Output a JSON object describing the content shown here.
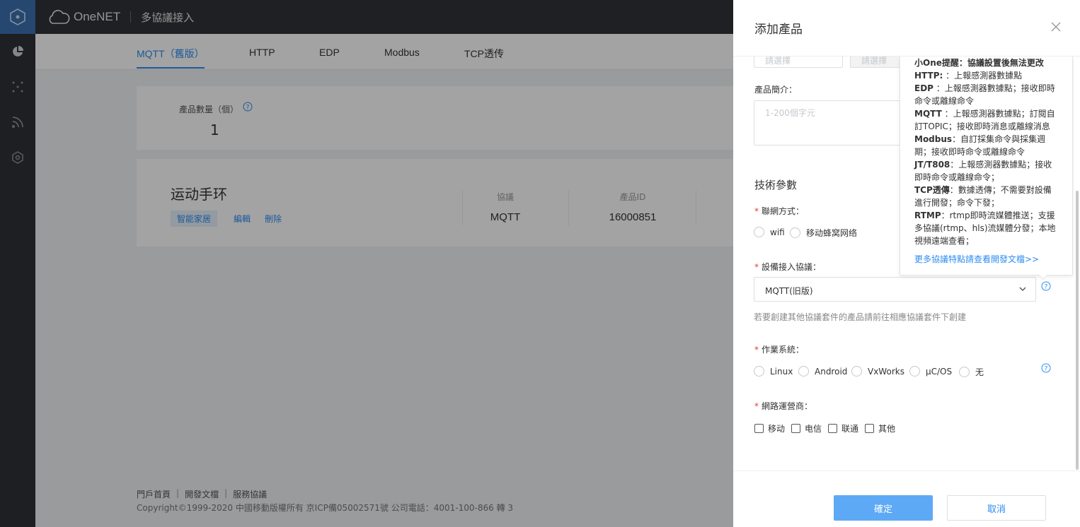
{
  "colors": {
    "accent": "#2d8cf0",
    "sidebar": "#2f3137",
    "topbar": "#303237",
    "required": "#e4393c",
    "ok_button": "#5ea9f5"
  },
  "topbar": {
    "logo_text": "OneNET",
    "title": "多協議接入"
  },
  "tabs": [
    {
      "label": "MQTT（舊版）",
      "active": true
    },
    {
      "label": "HTTP"
    },
    {
      "label": "EDP"
    },
    {
      "label": "Modbus"
    },
    {
      "label": "TCP透传"
    }
  ],
  "stats": {
    "label": "產品數量（個）",
    "value": "1"
  },
  "product": {
    "name": "运动手环",
    "tag": "智能家居",
    "edit": "編輯",
    "delete": "刪除",
    "protocol_header": "協議",
    "protocol": "MQTT",
    "id_header": "產品ID",
    "id": "16000851"
  },
  "footer": {
    "links": [
      "門戶首頁",
      "開發文檔",
      "服務協議"
    ],
    "copyright": "Copyright©1999-2020 中國移動版權所有 京ICP備05002571號 公司電話：4001-100-866 轉 3"
  },
  "drawer": {
    "title": "添加產品",
    "top_input1_placeholder": "請選擇",
    "top_input2_placeholder": "請選擇",
    "desc_label": "產品簡介：",
    "desc_placeholder": "1-200個字元",
    "section_title": "技術參數",
    "network_label": "聯網方式：",
    "network_options": [
      "wifi",
      "移动蜂窝网络"
    ],
    "protocol_label": "設備接入協議：",
    "protocol_value": "MQTT(旧版)",
    "protocol_hint": "若要創建其他協議套件的產品請前往相應協議套件下創建",
    "os_label": "作業系統：",
    "os_options": [
      "Linux",
      "Android",
      "VxWorks",
      "μC/OS",
      "无"
    ],
    "carrier_label": "網路運營商：",
    "carrier_options": [
      "移动",
      "电信",
      "联通",
      "其他"
    ],
    "ok_button": "確定",
    "cancel_button": "取消"
  },
  "tooltip": {
    "title": "小One提醒：協議設置後無法更改",
    "items": [
      {
        "name": "HTTP:",
        "text": "：上報感測器數據點"
      },
      {
        "name": "EDP",
        "text": "：上報感測器數據點；接收即時命令或離線命令"
      },
      {
        "name": "MQTT",
        "text": "：上報感測器數據點；訂閱自訂TOPIC；接收即時消息或離線消息"
      },
      {
        "name": "Modbus",
        "text": "：自訂採集命令與採集週期；接收即時命令或離線命令"
      },
      {
        "name": "JT/T808",
        "text": "：上報感測器數據點；接收即時命令或離線命令；"
      },
      {
        "name": "TCP透傳",
        "text": "：數據透傳；不需要對設備進行開發；命令下發；"
      },
      {
        "name": "RTMP",
        "text": "：rtmp即時流媒體推送；支援多協議(rtmp、hls)流媒體分發；本地視頻遠端查看；"
      }
    ],
    "link": "更多協議特點請查看開發文檔>>"
  },
  "icons": {
    "close": "close-icon",
    "help": "question-circle-icon",
    "chevron": "chevron-down-icon"
  }
}
